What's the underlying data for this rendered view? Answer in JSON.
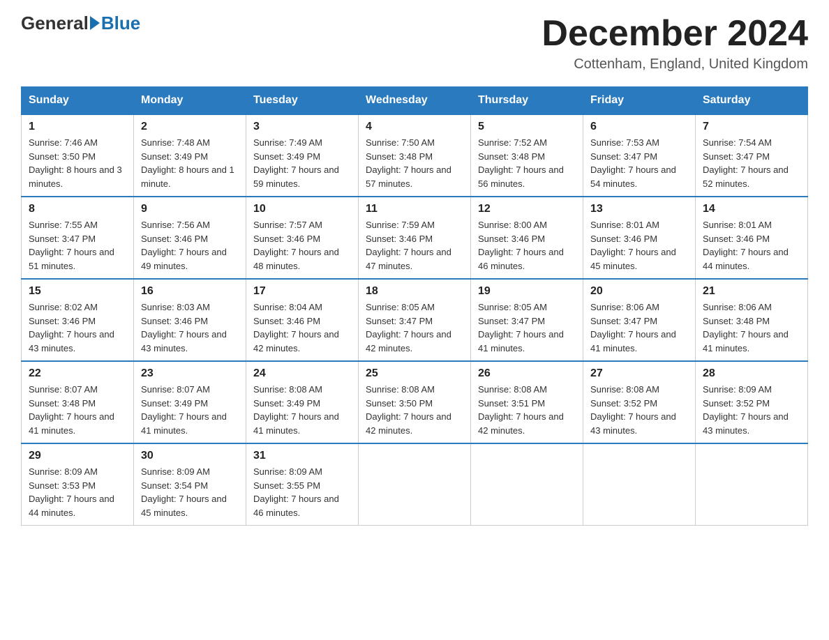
{
  "header": {
    "logo_general": "General",
    "logo_blue": "Blue",
    "month_title": "December 2024",
    "subtitle": "Cottenham, England, United Kingdom"
  },
  "days_of_week": [
    "Sunday",
    "Monday",
    "Tuesday",
    "Wednesday",
    "Thursday",
    "Friday",
    "Saturday"
  ],
  "weeks": [
    [
      {
        "day": "1",
        "sunrise": "7:46 AM",
        "sunset": "3:50 PM",
        "daylight": "8 hours and 3 minutes."
      },
      {
        "day": "2",
        "sunrise": "7:48 AM",
        "sunset": "3:49 PM",
        "daylight": "8 hours and 1 minute."
      },
      {
        "day": "3",
        "sunrise": "7:49 AM",
        "sunset": "3:49 PM",
        "daylight": "7 hours and 59 minutes."
      },
      {
        "day": "4",
        "sunrise": "7:50 AM",
        "sunset": "3:48 PM",
        "daylight": "7 hours and 57 minutes."
      },
      {
        "day": "5",
        "sunrise": "7:52 AM",
        "sunset": "3:48 PM",
        "daylight": "7 hours and 56 minutes."
      },
      {
        "day": "6",
        "sunrise": "7:53 AM",
        "sunset": "3:47 PM",
        "daylight": "7 hours and 54 minutes."
      },
      {
        "day": "7",
        "sunrise": "7:54 AM",
        "sunset": "3:47 PM",
        "daylight": "7 hours and 52 minutes."
      }
    ],
    [
      {
        "day": "8",
        "sunrise": "7:55 AM",
        "sunset": "3:47 PM",
        "daylight": "7 hours and 51 minutes."
      },
      {
        "day": "9",
        "sunrise": "7:56 AM",
        "sunset": "3:46 PM",
        "daylight": "7 hours and 49 minutes."
      },
      {
        "day": "10",
        "sunrise": "7:57 AM",
        "sunset": "3:46 PM",
        "daylight": "7 hours and 48 minutes."
      },
      {
        "day": "11",
        "sunrise": "7:59 AM",
        "sunset": "3:46 PM",
        "daylight": "7 hours and 47 minutes."
      },
      {
        "day": "12",
        "sunrise": "8:00 AM",
        "sunset": "3:46 PM",
        "daylight": "7 hours and 46 minutes."
      },
      {
        "day": "13",
        "sunrise": "8:01 AM",
        "sunset": "3:46 PM",
        "daylight": "7 hours and 45 minutes."
      },
      {
        "day": "14",
        "sunrise": "8:01 AM",
        "sunset": "3:46 PM",
        "daylight": "7 hours and 44 minutes."
      }
    ],
    [
      {
        "day": "15",
        "sunrise": "8:02 AM",
        "sunset": "3:46 PM",
        "daylight": "7 hours and 43 minutes."
      },
      {
        "day": "16",
        "sunrise": "8:03 AM",
        "sunset": "3:46 PM",
        "daylight": "7 hours and 43 minutes."
      },
      {
        "day": "17",
        "sunrise": "8:04 AM",
        "sunset": "3:46 PM",
        "daylight": "7 hours and 42 minutes."
      },
      {
        "day": "18",
        "sunrise": "8:05 AM",
        "sunset": "3:47 PM",
        "daylight": "7 hours and 42 minutes."
      },
      {
        "day": "19",
        "sunrise": "8:05 AM",
        "sunset": "3:47 PM",
        "daylight": "7 hours and 41 minutes."
      },
      {
        "day": "20",
        "sunrise": "8:06 AM",
        "sunset": "3:47 PM",
        "daylight": "7 hours and 41 minutes."
      },
      {
        "day": "21",
        "sunrise": "8:06 AM",
        "sunset": "3:48 PM",
        "daylight": "7 hours and 41 minutes."
      }
    ],
    [
      {
        "day": "22",
        "sunrise": "8:07 AM",
        "sunset": "3:48 PM",
        "daylight": "7 hours and 41 minutes."
      },
      {
        "day": "23",
        "sunrise": "8:07 AM",
        "sunset": "3:49 PM",
        "daylight": "7 hours and 41 minutes."
      },
      {
        "day": "24",
        "sunrise": "8:08 AM",
        "sunset": "3:49 PM",
        "daylight": "7 hours and 41 minutes."
      },
      {
        "day": "25",
        "sunrise": "8:08 AM",
        "sunset": "3:50 PM",
        "daylight": "7 hours and 42 minutes."
      },
      {
        "day": "26",
        "sunrise": "8:08 AM",
        "sunset": "3:51 PM",
        "daylight": "7 hours and 42 minutes."
      },
      {
        "day": "27",
        "sunrise": "8:08 AM",
        "sunset": "3:52 PM",
        "daylight": "7 hours and 43 minutes."
      },
      {
        "day": "28",
        "sunrise": "8:09 AM",
        "sunset": "3:52 PM",
        "daylight": "7 hours and 43 minutes."
      }
    ],
    [
      {
        "day": "29",
        "sunrise": "8:09 AM",
        "sunset": "3:53 PM",
        "daylight": "7 hours and 44 minutes."
      },
      {
        "day": "30",
        "sunrise": "8:09 AM",
        "sunset": "3:54 PM",
        "daylight": "7 hours and 45 minutes."
      },
      {
        "day": "31",
        "sunrise": "8:09 AM",
        "sunset": "3:55 PM",
        "daylight": "7 hours and 46 minutes."
      },
      null,
      null,
      null,
      null
    ]
  ]
}
